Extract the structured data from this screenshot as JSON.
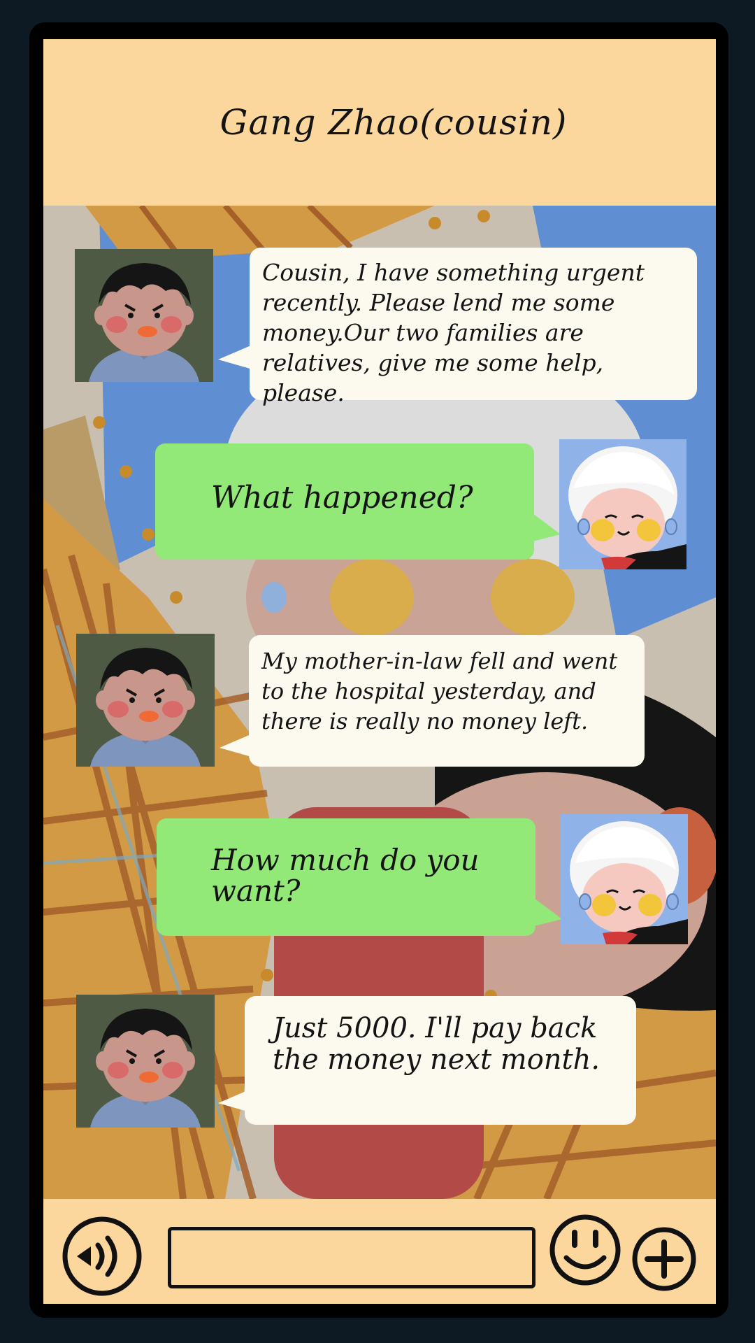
{
  "header": {
    "title": "Gang Zhao(cousin)"
  },
  "messages": [
    {
      "sender": "Gang Zhao",
      "side": "incoming",
      "text": "Cousin, I have something urgent recently. Please lend me some money.Our two families are relatives, give me some help, please."
    },
    {
      "sender": "me",
      "side": "outgoing",
      "text": "What happened?"
    },
    {
      "sender": "Gang Zhao",
      "side": "incoming",
      "text": "My mother-in-law fell and went to the hospital yesterday, and there is really no money left."
    },
    {
      "sender": "me",
      "side": "outgoing",
      "text": "How much do you want?"
    },
    {
      "sender": "Gang Zhao",
      "side": "incoming",
      "text": "Just 5000. I'll pay back the money next month."
    }
  ],
  "toolbar": {
    "voice_icon": "speaker-voice-icon",
    "input_value": "",
    "emoji_icon": "smiley-emoji-icon",
    "plus_icon": "plus-circle-icon"
  },
  "colors": {
    "frame": "#000000",
    "header_bg": "#fbd79e",
    "incoming_bubble": "#fcf9ee",
    "outgoing_bubble": "#93e978",
    "avatar_bg_cousin": "#4f5a45",
    "outer_bg": "#0d1a24"
  }
}
